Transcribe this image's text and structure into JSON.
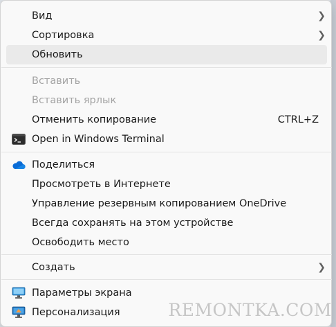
{
  "menu": {
    "view": {
      "label": "Вид",
      "icon": "chevron-right-icon"
    },
    "sort": {
      "label": "Сортировка",
      "icon": "chevron-right-icon"
    },
    "refresh": {
      "label": "Обновить"
    },
    "paste": {
      "label": "Вставить",
      "disabled": true
    },
    "paste_shortcut": {
      "label": "Вставить ярлык",
      "disabled": true
    },
    "undo_copy": {
      "label": "Отменить копирование",
      "shortcut": "CTRL+Z"
    },
    "terminal": {
      "label": "Open in Windows Terminal",
      "icon": "terminal-icon"
    },
    "share": {
      "label": "Поделиться",
      "icon": "onedrive-cloud-icon"
    },
    "view_online": {
      "label": "Просмотреть в Интернете"
    },
    "manage_backup": {
      "label": "Управление резервным копированием OneDrive"
    },
    "always_keep": {
      "label": "Всегда сохранять на этом устройстве"
    },
    "free_space": {
      "label": "Освободить место"
    },
    "create": {
      "label": "Создать",
      "icon": "chevron-right-icon"
    },
    "display_settings": {
      "label": "Параметры экрана",
      "icon": "display-settings-icon"
    },
    "personalize": {
      "label": "Персонализация",
      "icon": "personalize-icon"
    }
  },
  "watermark": "REMONTKA.COM",
  "colors": {
    "accent": "#0078d4",
    "disabled_text": "#a3a3a3",
    "hover_bg": "#eaeaea"
  }
}
